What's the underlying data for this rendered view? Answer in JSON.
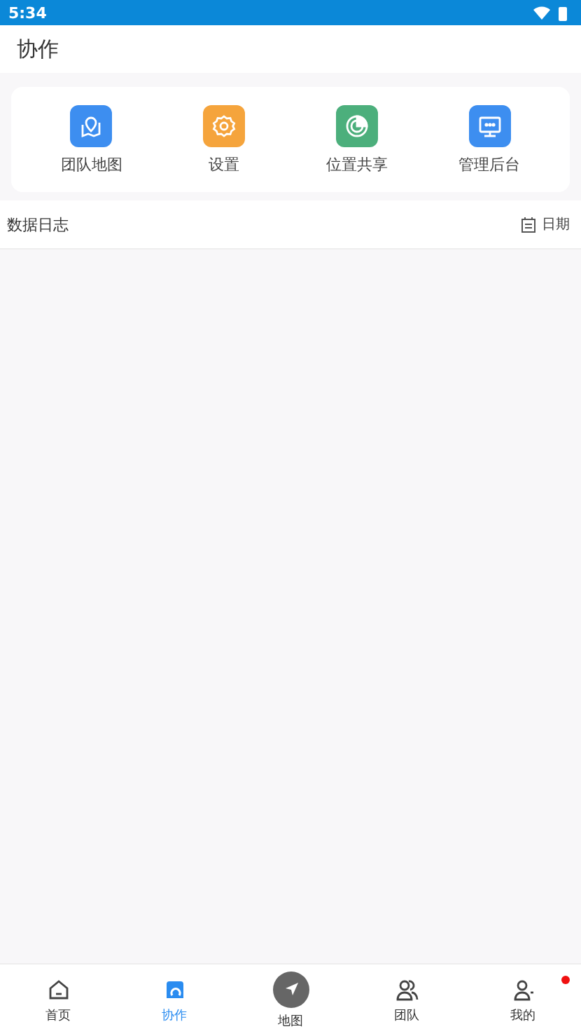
{
  "status_bar": {
    "time": "5:34"
  },
  "header": {
    "title": "协作"
  },
  "shortcuts": [
    {
      "label": "团队地图",
      "kind": "map",
      "color": "#3d8ef0"
    },
    {
      "label": "设置",
      "kind": "gear",
      "color": "#f5a43c"
    },
    {
      "label": "位置共享",
      "kind": "radar",
      "color": "#4caf7c"
    },
    {
      "label": "管理后台",
      "kind": "monitor",
      "color": "#3d8ef0"
    }
  ],
  "log_section": {
    "title": "数据日志",
    "date_button": "日期"
  },
  "bottom_nav": [
    {
      "label": "首页",
      "kind": "home",
      "selected": false,
      "badge": false
    },
    {
      "label": "协作",
      "kind": "collab",
      "selected": true,
      "badge": false
    },
    {
      "label": "地图",
      "kind": "map",
      "selected": false,
      "badge": false
    },
    {
      "label": "团队",
      "kind": "team",
      "selected": false,
      "badge": false
    },
    {
      "label": "我的",
      "kind": "me",
      "selected": false,
      "badge": true
    }
  ]
}
